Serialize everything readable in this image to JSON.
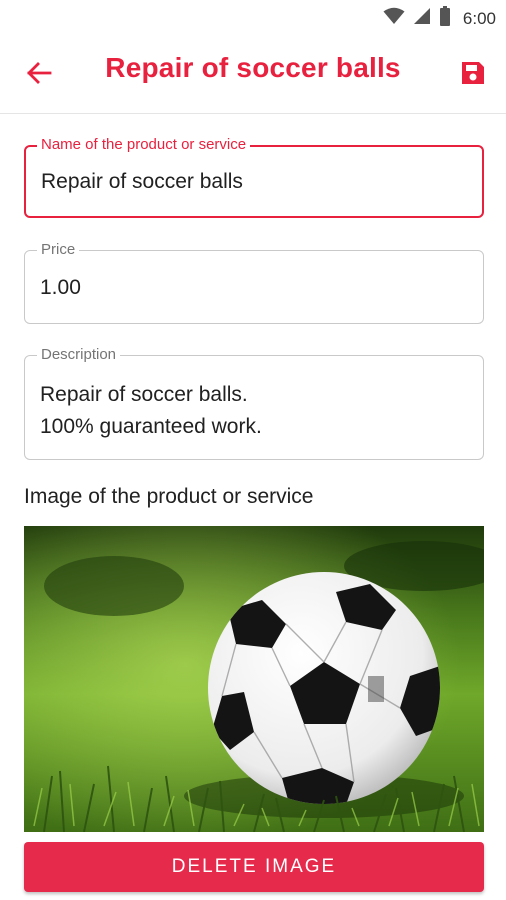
{
  "status_bar": {
    "time": "6:00"
  },
  "app_bar": {
    "title": "Repair of soccer balls"
  },
  "form": {
    "name": {
      "label": "Name of the product or service",
      "value": "Repair of soccer balls"
    },
    "price": {
      "label": "Price",
      "value": "1.00"
    },
    "description": {
      "label": "Description",
      "value": "Repair of soccer balls.\n100% guaranteed work."
    }
  },
  "image_section": {
    "label": "Image of the product or service"
  },
  "delete_button": {
    "label": "DELETE IMAGE"
  },
  "colors": {
    "accent": "#e8213f",
    "button": "#e62a4b"
  }
}
